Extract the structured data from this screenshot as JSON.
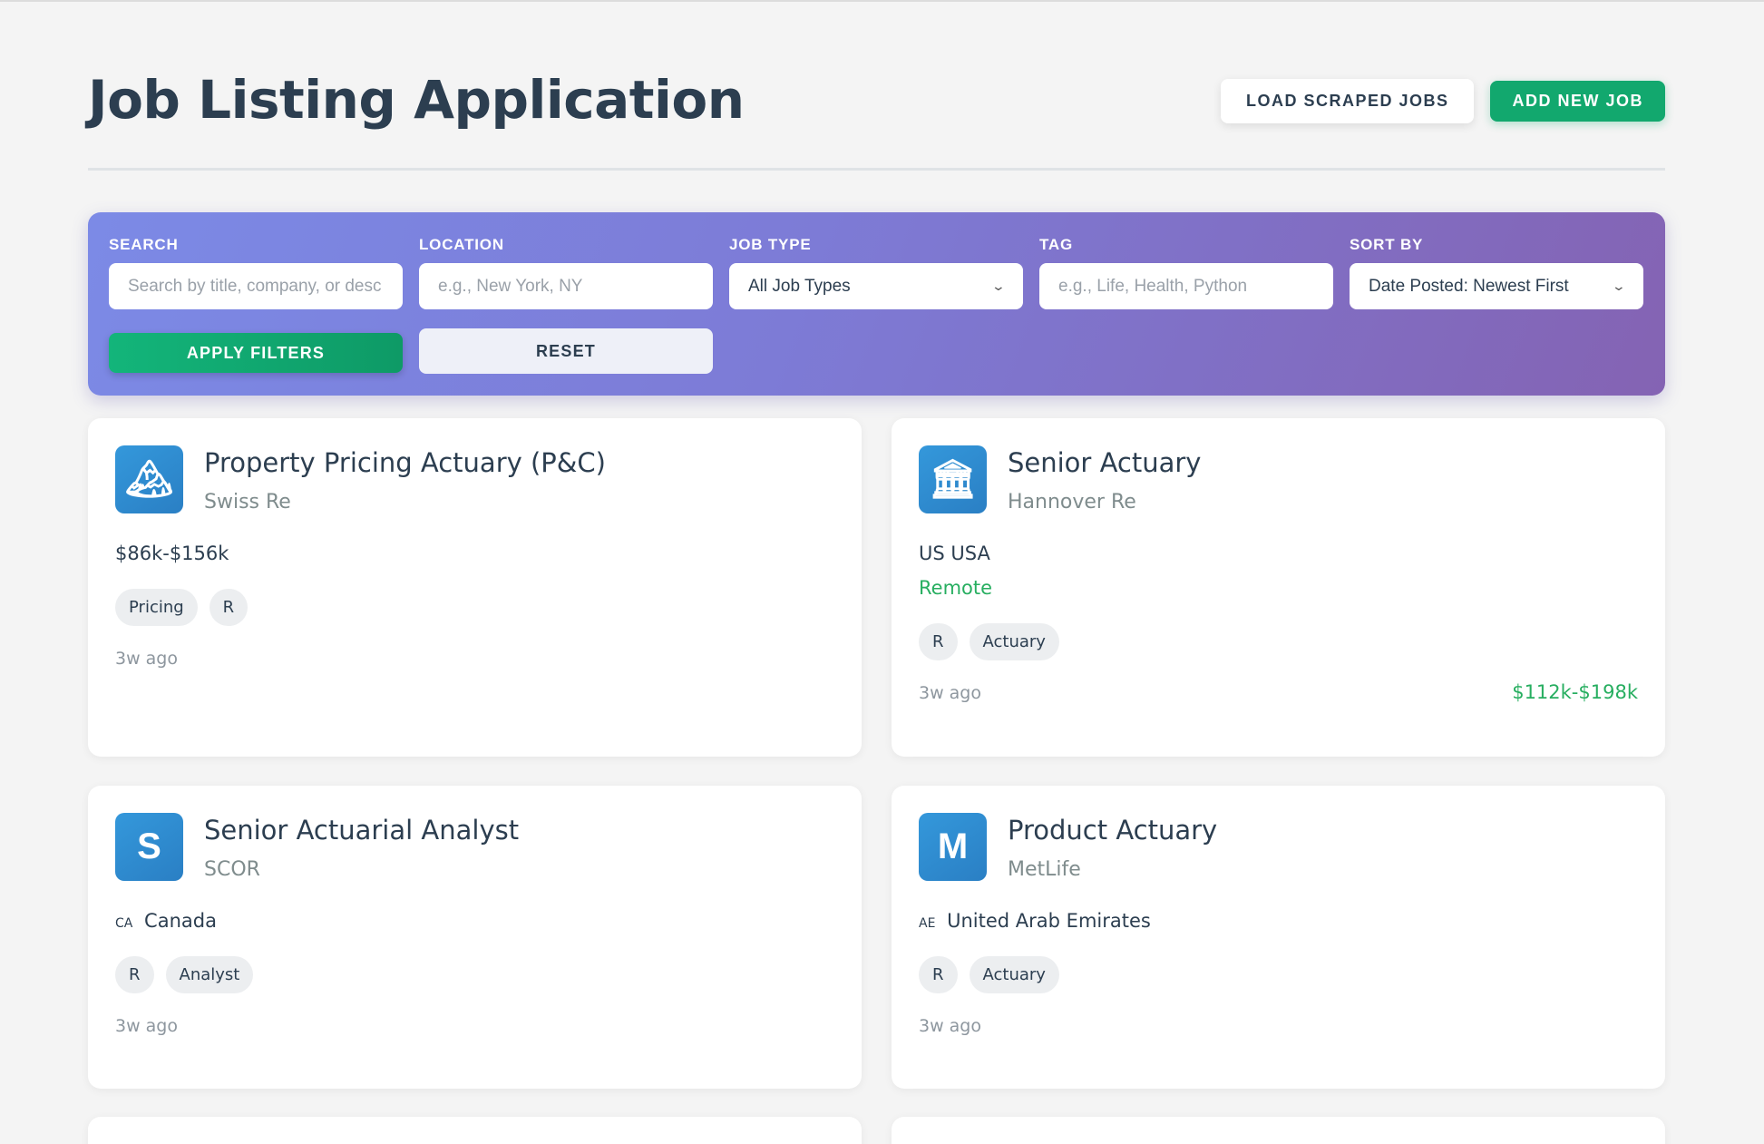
{
  "header": {
    "title": "Job Listing Application",
    "load_label": "LOAD SCRAPED JOBS",
    "add_label": "ADD NEW JOB"
  },
  "filters": {
    "search": {
      "label": "SEARCH",
      "placeholder": "Search by title, company, or desc"
    },
    "location": {
      "label": "LOCATION",
      "placeholder": "e.g., New York, NY"
    },
    "job_type": {
      "label": "JOB TYPE",
      "value": "All Job Types"
    },
    "tag": {
      "label": "TAG",
      "placeholder": "e.g., Life, Health, Python"
    },
    "sort": {
      "label": "SORT BY",
      "value": "Date Posted: Newest First"
    },
    "apply_label": "APPLY FILTERS",
    "reset_label": "RESET"
  },
  "jobs": [
    {
      "logo_icon": "mountain-icon",
      "logo_glyph": "🏔",
      "title": "Property Pricing Actuary (P&C)",
      "company": "Swiss Re",
      "salary": "$86k-$156k",
      "tags": [
        "Pricing",
        "R"
      ],
      "posted": "3w ago"
    },
    {
      "logo_icon": "bank-icon",
      "logo_glyph": "🏛",
      "title": "Senior Actuary",
      "company": "Hannover Re",
      "location_code": "US",
      "location": "USA",
      "remote": "Remote",
      "tags": [
        "R",
        "Actuary"
      ],
      "posted": "3w ago",
      "salary": "$112k-$198k"
    },
    {
      "logo_icon": "letter-s-icon",
      "logo_glyph": "S",
      "title": "Senior Actuarial Analyst",
      "company": "SCOR",
      "location_code": "CA",
      "location": "Canada",
      "tags": [
        "R",
        "Analyst"
      ],
      "posted": "3w ago"
    },
    {
      "logo_icon": "letter-m-icon",
      "logo_glyph": "M",
      "title": "Product Actuary",
      "company": "MetLife",
      "location_code": "AE",
      "location": "United Arab Emirates",
      "tags": [
        "R",
        "Actuary"
      ],
      "posted": "3w ago"
    }
  ]
}
